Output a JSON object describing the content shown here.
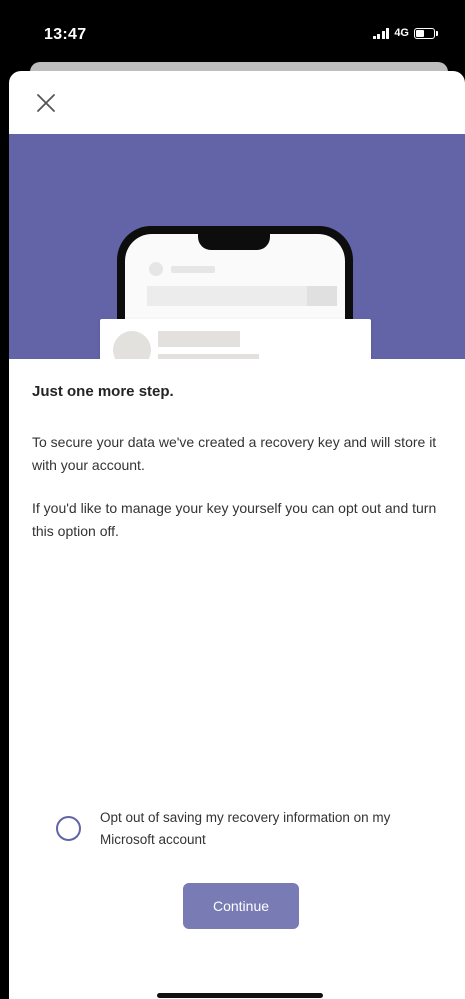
{
  "status_bar": {
    "time": "13:47",
    "network": "4G"
  },
  "modal": {
    "close_icon": "close-icon",
    "title": "Just one more step.",
    "paragraph1": "To secure your data we've created a recovery key and will store it with your account.",
    "paragraph2": "If you'd like to manage your key yourself you can opt out and turn this option off.",
    "opt_out": {
      "label": "Opt out of saving my recovery information on my Microsoft account",
      "checked": false
    },
    "continue_label": "Continue"
  },
  "colors": {
    "accent": "#6264a7",
    "background": "#ffffff",
    "status_bar": "#000000"
  }
}
